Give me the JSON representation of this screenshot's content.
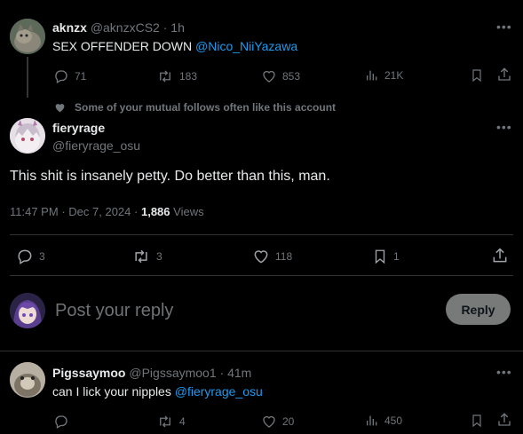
{
  "tweet1": {
    "display_name": "aknzx",
    "handle": "@aknzxCS2",
    "separator": "·",
    "time": "1h",
    "text": "SEX OFFENDER DOWN",
    "mention": "@Nico_NiiYazawa",
    "replies": "71",
    "reposts": "183",
    "likes": "853",
    "views": "21K"
  },
  "social_context": "Some of your mutual follows often like this account",
  "main_tweet": {
    "display_name": "fieryrage",
    "handle": "@fieryrage_osu",
    "text": "This shit is insanely petty. Do better than this, man.",
    "time": "11:47 PM",
    "date_sep": "·",
    "date": "Dec 7, 2024",
    "views_sep": "·",
    "views_count": "1,886",
    "views_label": "Views",
    "replies": "3",
    "reposts": "3",
    "likes": "118",
    "bookmarks": "1"
  },
  "reply_box": {
    "placeholder": "Post your reply",
    "button_label": "Reply"
  },
  "tweet3": {
    "display_name": "Pigssaymoo",
    "handle": "@Pigssaymoo1",
    "separator": "·",
    "time": "41m",
    "text": "can I lick your nipples",
    "mention": "@fieryrage_osu",
    "reposts": "4",
    "likes": "20",
    "views": "450"
  },
  "icons": {
    "more": "more-dots-icon",
    "reply": "reply-bubble-icon",
    "repost": "repost-icon",
    "like": "heart-icon",
    "views": "analytics-bars-icon",
    "bookmark": "bookmark-icon",
    "share": "share-upload-icon"
  },
  "colors": {
    "background": "#000000",
    "text": "#e7e9ea",
    "muted": "#71767b",
    "link": "#1d9bf0",
    "divider": "#2f3336",
    "reply_button_bg": "#787a7a"
  }
}
